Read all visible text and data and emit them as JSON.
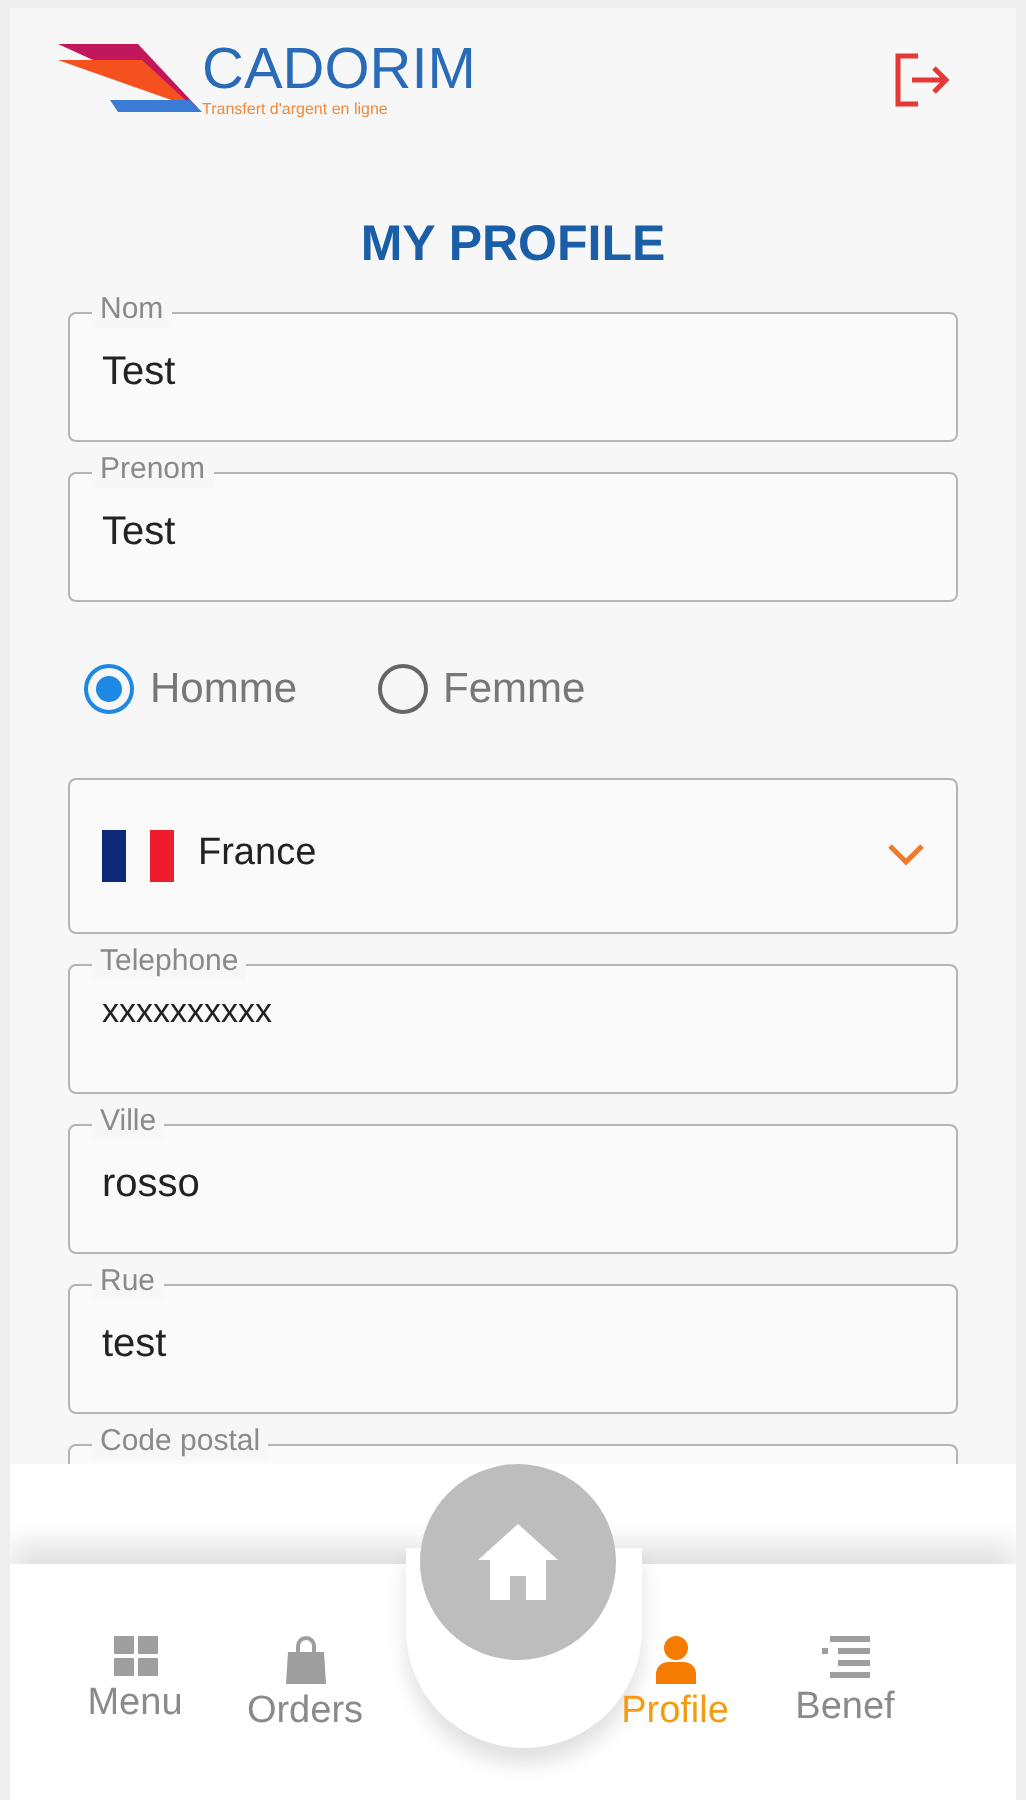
{
  "header": {
    "logo_name": "CADORIM",
    "logo_tagline": "Transfert d'argent en ligne"
  },
  "title": "MY PROFILE",
  "fields": [
    {
      "kind": "text",
      "label": "Nom",
      "value": "Test"
    },
    {
      "kind": "text",
      "label": "Prenom",
      "value": "Test"
    },
    {
      "kind": "radio",
      "options": [
        {
          "label": "Homme",
          "selected": true
        },
        {
          "label": "Femme",
          "selected": false
        }
      ]
    },
    {
      "kind": "select",
      "value": "France"
    },
    {
      "kind": "text",
      "label": "Telephone",
      "value": "xxxxxxxxxx",
      "small": true
    },
    {
      "kind": "text",
      "label": "Ville",
      "value": "rosso"
    },
    {
      "kind": "text",
      "label": "Rue",
      "value": "test"
    },
    {
      "kind": "text",
      "label": "Code postal"
    }
  ],
  "nav": {
    "items": [
      {
        "label": "Menu",
        "selected": false
      },
      {
        "label": "Orders",
        "selected": false
      },
      {
        "label": "Profile",
        "selected": true
      },
      {
        "label": "Benef",
        "selected": false
      }
    ]
  }
}
